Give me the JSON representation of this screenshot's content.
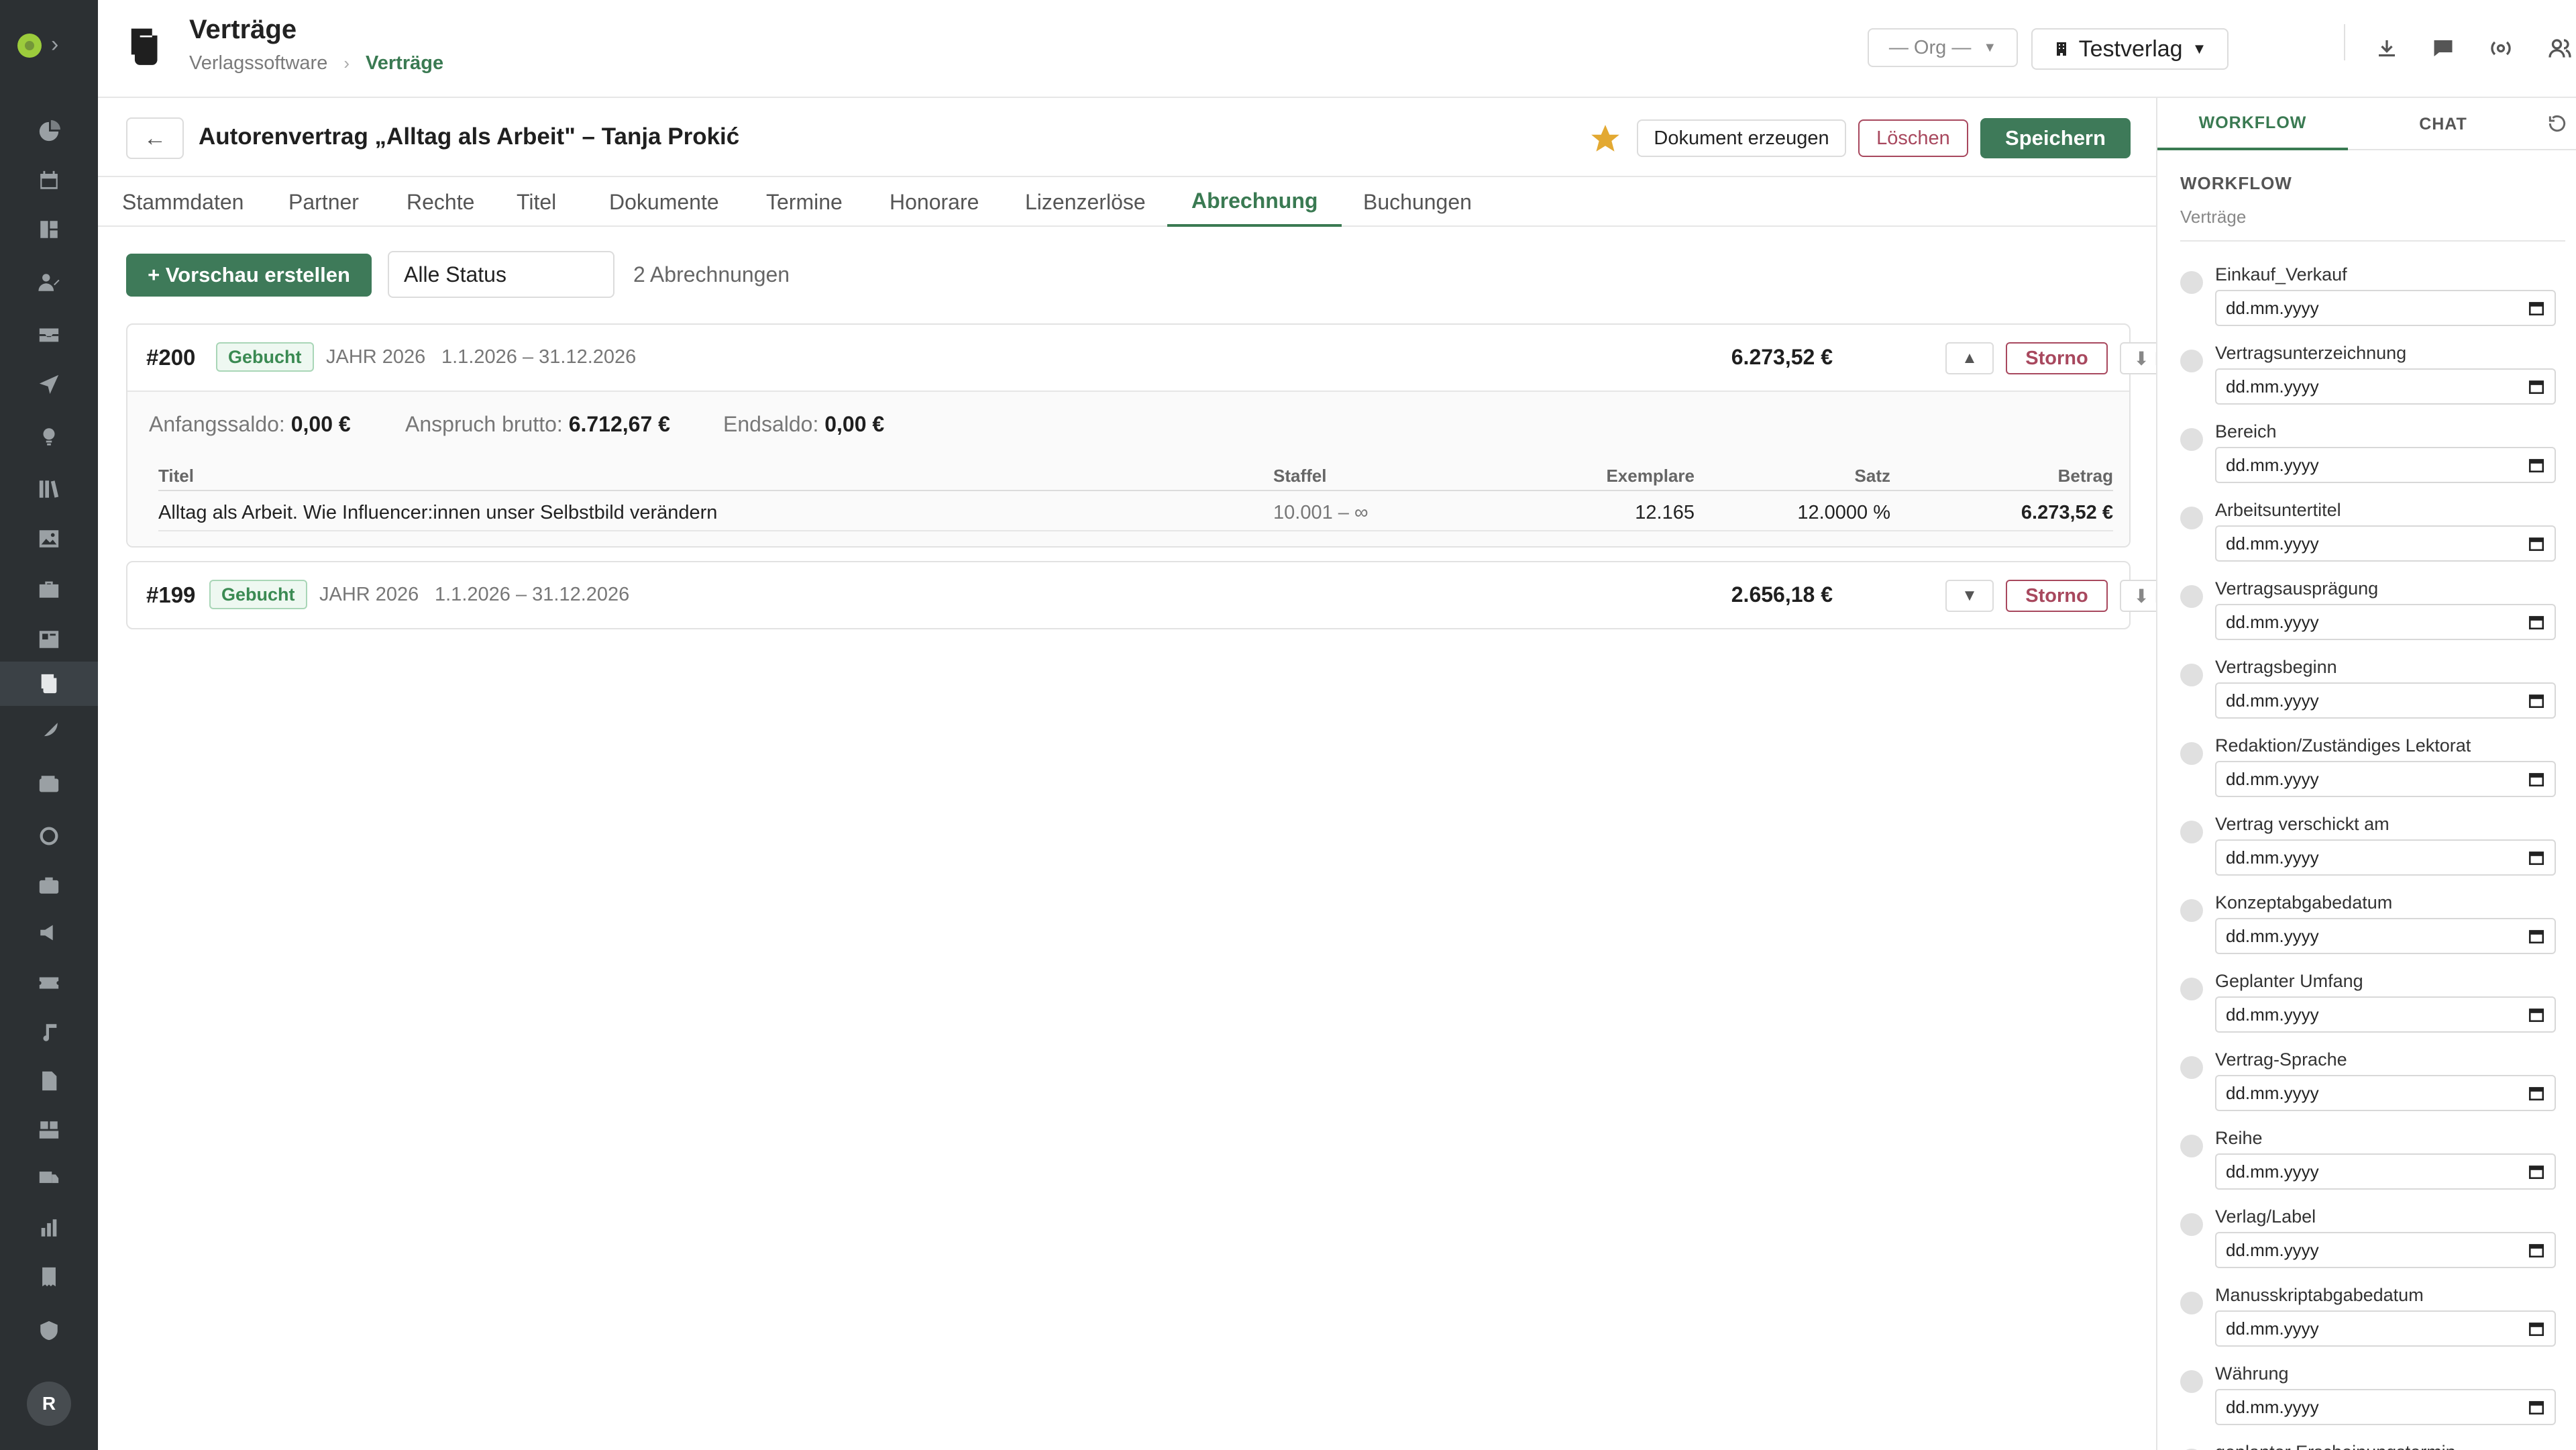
{
  "header": {
    "title": "Verträge",
    "breadcrumb_root": "Verlagssoftware",
    "breadcrumb_sep": "›",
    "breadcrumb_current": "Verträge",
    "org_select": "— Org —",
    "verlag_select": "Testverlag"
  },
  "contract": {
    "back_label": "←",
    "title": "Autorenvertrag „Alltag als Arbeit\" – Tanja Prokić",
    "btn_document": "Dokument erzeugen",
    "btn_delete": "Löschen",
    "btn_save": "Speichern"
  },
  "tabs": [
    "Stammdaten",
    "Partner",
    "Rechte",
    "Titel",
    "Dokumente",
    "Termine",
    "Honorare",
    "Lizenzerlöse",
    "Abrechnung",
    "Buchungen"
  ],
  "toolbar": {
    "preview_label": "+ Vorschau erstellen",
    "status_filter": "Alle Status",
    "count_label": "2 Abrechnungen"
  },
  "statements": [
    {
      "number": "#200",
      "status": "Gebucht",
      "year": "JAHR 2026",
      "period": "1.1.2026 – 31.12.2026",
      "amount": "6.273,52 €",
      "toggle": "▲",
      "storno": "Storno",
      "pdf": "⬇ PDF",
      "anfangssaldo_label": "Anfangssaldo:",
      "anfangssaldo": "0,00 €",
      "anspruch_label": "Anspruch brutto:",
      "anspruch": "6.712,67 €",
      "endsaldo_label": "Endsaldo:",
      "endsaldo": "0,00 €",
      "columns": [
        "Titel",
        "Staffel",
        "Exemplare",
        "Satz",
        "Betrag"
      ],
      "rows": [
        {
          "titel": "Alltag als Arbeit. Wie Influencer:innen unser Selbstbild verändern",
          "staffel": "10.001 – ∞",
          "exemplare": "12.165",
          "satz": "12.0000 %",
          "betrag": "6.273,52 €"
        }
      ]
    },
    {
      "number": "#199",
      "status": "Gebucht",
      "year": "JAHR 2026",
      "period": "1.1.2026 – 31.12.2026",
      "amount": "2.656,18 €",
      "toggle": "▼",
      "storno": "Storno",
      "pdf": "⬇ PDF"
    }
  ],
  "panel": {
    "tab_workflow": "WORKFLOW",
    "tab_chat": "CHAT",
    "section_title": "WORKFLOW",
    "section_sub": "Verträge",
    "date_placeholder": "dd.mm.yyyy",
    "items": [
      "Einkauf_Verkauf",
      "Vertragsunterzeichnung",
      "Bereich",
      "Arbeitsuntertitel",
      "Vertragsausprägung",
      "Vertragsbeginn",
      "Redaktion/Zuständiges Lektorat",
      "Vertrag verschickt am",
      "Konzeptabgabedatum",
      "Geplanter Umfang",
      "Vertrag-Sprache",
      "Reihe",
      "Verlag/Label",
      "Manusskriptabgabedatum",
      "Währung",
      "geplanter Erscheinungstermin"
    ]
  },
  "user": {
    "avatar_initial": "R"
  },
  "colors": {
    "accent": "#3e7a59",
    "danger": "#a8485e",
    "rail": "#2c3033",
    "badge_bg": "#eef8f1",
    "star": "#e3a932"
  }
}
